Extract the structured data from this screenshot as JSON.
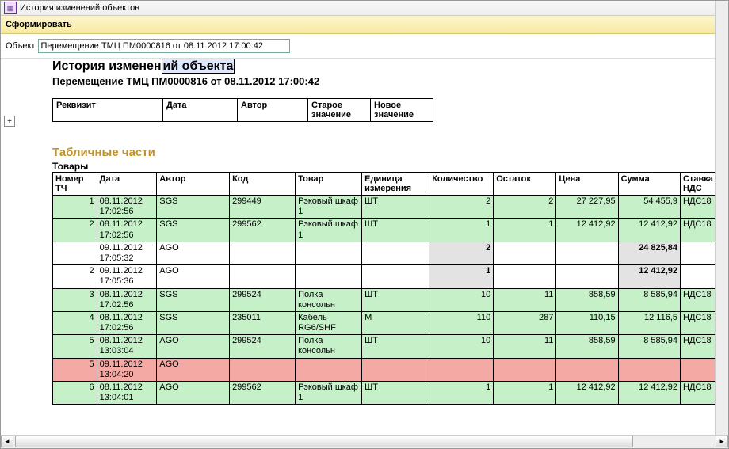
{
  "window": {
    "title": "История изменений объектов"
  },
  "toolbar": {
    "form": "Сформировать"
  },
  "obj": {
    "label": "Объект",
    "value": "Перемещение ТМЦ ПМ0000816 от 08.11.2012 17:00:42"
  },
  "report": {
    "title_a": "История изменен",
    "title_b": "ий объекта",
    "sub": "Перемещение ТМЦ ПМ0000816 от 08.11.2012 17:00:42",
    "header": {
      "c1": "Реквизит",
      "c2": "Дата",
      "c3": "Автор",
      "c4": "Старое значение",
      "c5": "Новое значение"
    }
  },
  "tab": {
    "title": "Табличные части",
    "subtitle": "Товары",
    "cols": {
      "c1": "Номер ТЧ",
      "c2": "Дата",
      "c3": "Автор",
      "c4": "Код",
      "c5": "Товар",
      "c6": "Единица измерения",
      "c7": "Количество",
      "c8": "Остаток",
      "c9": "Цена",
      "c10": "Сумма",
      "c11": "Ставка НДС"
    },
    "rows": [
      {
        "cls": "green",
        "n": "1",
        "date": "08.11.2012 17:02:56",
        "author": "SGS",
        "code": "299449",
        "good": "Рэковый шкаф 1",
        "unit": "ШТ",
        "qnt": "2",
        "rest": "2",
        "price": "27 227,95",
        "sum": "54 455,9",
        "vat": "НДС18"
      },
      {
        "cls": "green",
        "n": "2",
        "date": "08.11.2012 17:02:56",
        "author": "SGS",
        "code": "299562",
        "good": "Рэковый шкаф 1",
        "unit": "ШТ",
        "qnt": "1",
        "rest": "1",
        "price": "12 412,92",
        "sum": "12 412,92",
        "vat": "НДС18"
      },
      {
        "cls": "white",
        "n": "",
        "date": "09.11.2012 17:05:32",
        "author": "AGO",
        "code": "",
        "good": "",
        "unit": "",
        "qnt": "2",
        "rest": "",
        "price": "",
        "sum": "24 825,84",
        "vat": ""
      },
      {
        "cls": "white",
        "n": "2",
        "date": "09.11.2012 17:05:36",
        "author": "AGO",
        "code": "",
        "good": "",
        "unit": "",
        "qnt": "1",
        "rest": "",
        "price": "",
        "sum": "12 412,92",
        "vat": ""
      },
      {
        "cls": "green",
        "n": "3",
        "date": "08.11.2012 17:02:56",
        "author": "SGS",
        "code": "299524",
        "good": "Полка консольн",
        "unit": "ШТ",
        "qnt": "10",
        "rest": "11",
        "price": "858,59",
        "sum": "8 585,94",
        "vat": "НДС18"
      },
      {
        "cls": "green",
        "n": "4",
        "date": "08.11.2012 17:02:56",
        "author": "SGS",
        "code": "235011",
        "good": "Кабель RG6/SHF",
        "unit": "М",
        "qnt": "110",
        "rest": "287",
        "price": "110,15",
        "sum": "12 116,5",
        "vat": "НДС18"
      },
      {
        "cls": "green",
        "n": "5",
        "date": "08.11.2012 13:03:04",
        "author": "AGO",
        "code": "299524",
        "good": "Полка консольн",
        "unit": "ШТ",
        "qnt": "10",
        "rest": "11",
        "price": "858,59",
        "sum": "8 585,94",
        "vat": "НДС18"
      },
      {
        "cls": "red",
        "n": "5",
        "date": "09.11.2012 13:04:20",
        "author": "AGO",
        "code": "",
        "good": "",
        "unit": "",
        "qnt": "",
        "rest": "",
        "price": "",
        "sum": "",
        "vat": ""
      },
      {
        "cls": "green",
        "n": "6",
        "date": "08.11.2012 13:04:01",
        "author": "AGO",
        "code": "299562",
        "good": "Рэковый шкаф 1",
        "unit": "ШТ",
        "qnt": "1",
        "rest": "1",
        "price": "12 412,92",
        "sum": "12 412,92",
        "vat": "НДС18"
      }
    ]
  }
}
